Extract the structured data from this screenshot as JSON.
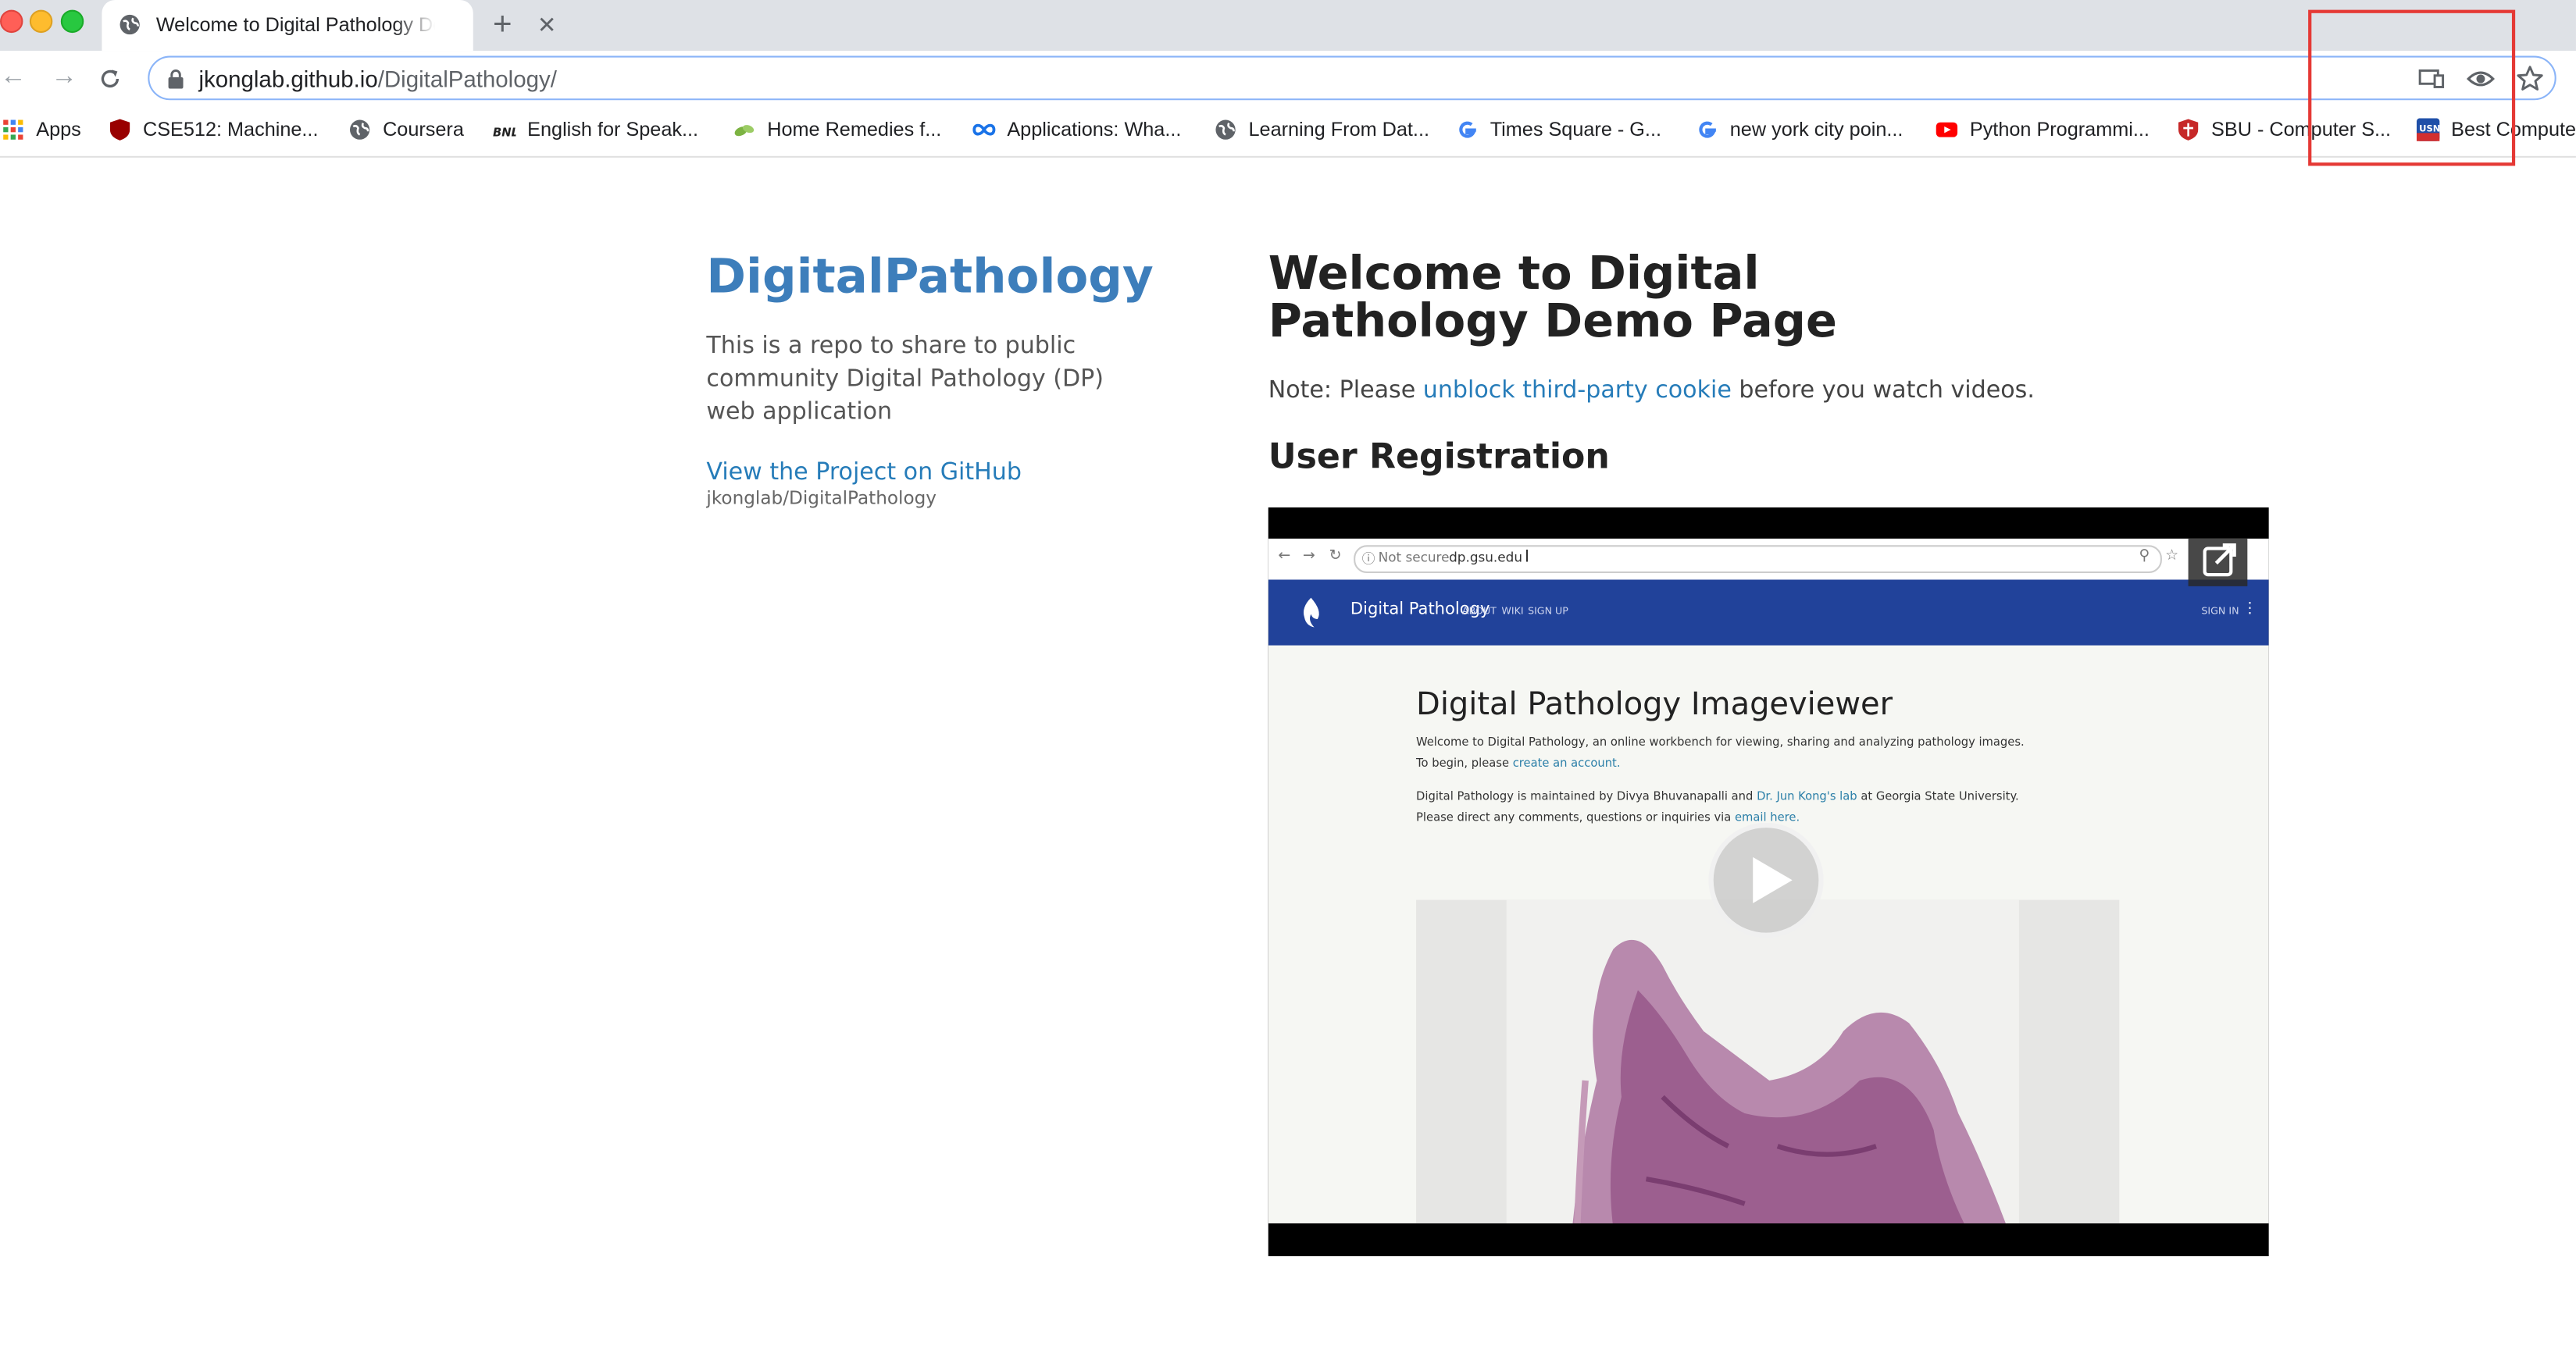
{
  "browser": {
    "tab_title": "Welcome to Digital Pathology Demo Page",
    "new_tab_glyph": "+",
    "tab_close_glyph": "✕",
    "url_host": "jkonglab.github.io",
    "url_path": "/DigitalPathology/"
  },
  "bookmarks": [
    {
      "label": "Apps",
      "icon": "apps-grid-icon"
    },
    {
      "label": "CSE512: Machine...",
      "icon": "shield-icon"
    },
    {
      "label": "Coursera",
      "icon": "globe-icon"
    },
    {
      "label": "English for Speak...",
      "icon": "bnl-icon"
    },
    {
      "label": "Home Remedies f...",
      "icon": "leaf-icon"
    },
    {
      "label": "Applications: Wha...",
      "icon": "infinity-icon"
    },
    {
      "label": "Learning From Dat...",
      "icon": "globe-icon"
    },
    {
      "label": "Times Square - G...",
      "icon": "google-icon"
    },
    {
      "label": "new york city poin...",
      "icon": "google-icon"
    },
    {
      "label": "Python Programmi...",
      "icon": "youtube-icon"
    },
    {
      "label": "SBU - Computer S...",
      "icon": "shield-icon"
    },
    {
      "label": "Best Computer",
      "icon": "usnews-icon"
    }
  ],
  "sidebar": {
    "site_title": "DigitalPathology",
    "description": "This is a repo to share to public community Digital Pathology (DP) web application",
    "github_link": "View the Project on GitHub",
    "github_repo": "jkonglab/DigitalPathology"
  },
  "main": {
    "title": "Welcome to Digital Pathology Demo Page",
    "note_prefix": "Note: Please",
    "note_link": "unblock third-party cookie",
    "note_suffix": "before you watch videos.",
    "section_title": "User Registration"
  },
  "video": {
    "not_secure": "Not secure",
    "url": "dp.gsu.edu",
    "brand": "Digital Pathology",
    "menu": [
      "ABOUT",
      "WIKI",
      "SIGN UP"
    ],
    "signin": "SIGN IN",
    "heading": "Digital Pathology Imageviewer",
    "line1": "Welcome to Digital Pathology, an online workbench for viewing, sharing and analyzing pathology images.",
    "line2_prefix": "To begin, please",
    "line2_link": "create an account.",
    "line3_prefix": "Digital Pathology is maintained by Divya Bhuvanapalli and",
    "line3_link": "Dr. Jun Kong's lab",
    "line3_suffix": "at Georgia State University.",
    "line4_prefix": "Please direct any comments, questions or inquiries via",
    "line4_link": "email here."
  },
  "colors": {
    "site_title": "#3d7ebb",
    "link": "#267cb9",
    "video_header": "#21429a",
    "highlight_box": "#e53935"
  }
}
